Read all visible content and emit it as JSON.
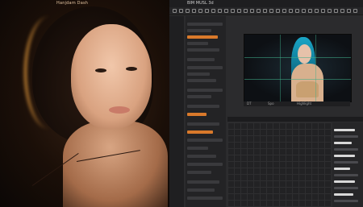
{
  "photo": {
    "caption": "Hanjdam Dash"
  },
  "editor": {
    "title": "BIM MUSL 3d"
  },
  "viewer": {
    "bar_labels": [
      "DT",
      "Spo",
      "Highlight"
    ]
  },
  "colors": {
    "accent": "#d9792b",
    "guide": "#3fae8a",
    "hair_cyan": "#1aa6c7"
  }
}
